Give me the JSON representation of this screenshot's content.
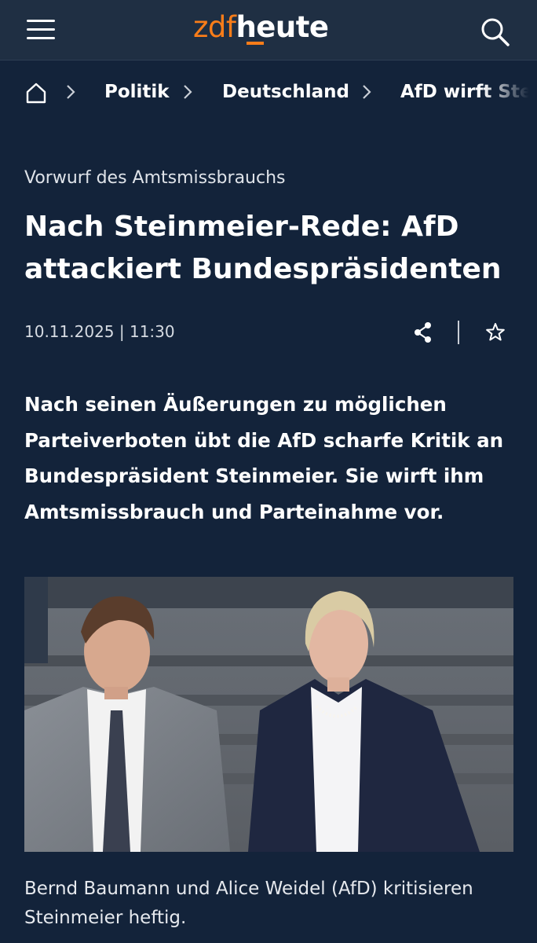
{
  "header": {
    "menu_icon": "hamburger-menu-icon",
    "logo_prefix": "zdf",
    "logo_main": "heute",
    "search_icon": "search-icon",
    "brand_color": "#fa7d19",
    "background_color": "#1f2f43"
  },
  "breadcrumb": {
    "home_icon": "home-icon",
    "items": [
      {
        "label": "Politik"
      },
      {
        "label": "Deutschland"
      },
      {
        "label": "AfD wirft Stei"
      }
    ]
  },
  "article": {
    "kicker": "Vorwurf des Amtsmissbrauchs",
    "headline": "Nach Steinmeier-Rede: AfD attackiert Bundespräsidenten",
    "date": "10.11.2025",
    "time": "11:30",
    "share_icon": "share-icon",
    "bookmark_icon": "star-icon",
    "lead": "Nach seinen Äußerungen zu möglichen Parteiverboten übt die AfD scharfe Kritik an Bundespräsident Steinmeier. Sie wirft ihm Amtsmissbrauch und Parteinahme vor.",
    "image_caption": "Bernd Baumann und Alice Weidel (AfD) kritisieren Steinmeier heftig."
  },
  "colors": {
    "page_background": "#13233a",
    "text": "#ffffff"
  }
}
